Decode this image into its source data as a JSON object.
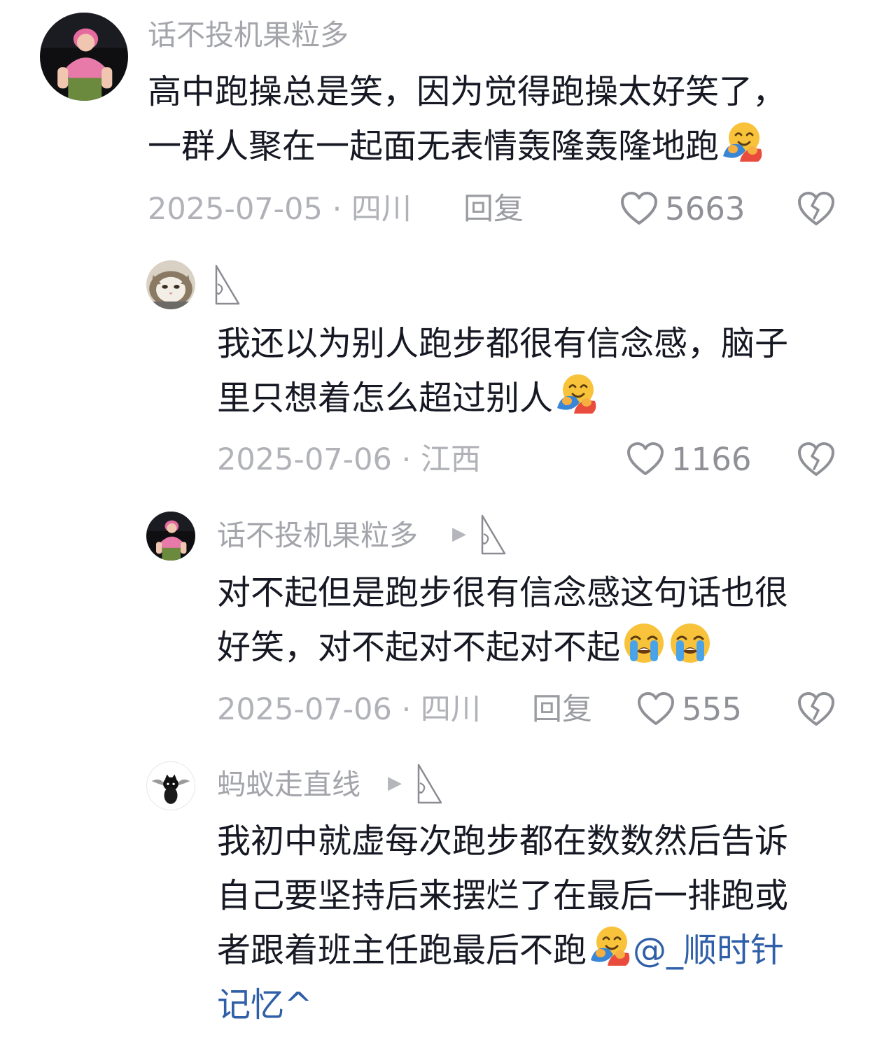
{
  "comments": [
    {
      "username": "话不投机果粒多",
      "lines": [
        "高中跑操总是笑，因为觉得跑操太好笑了，",
        "一群人聚在一起面无表情轰隆轰隆地跑"
      ],
      "date": "2025-07-05",
      "location": "四川",
      "reply_label": "回复",
      "likes": "5663",
      "emoji_icon": "hugging-face-emoji-icon"
    },
    {
      "username": "",
      "lines": [
        "我还以为别人跑步都很有信念感，脑子",
        "里只想着怎么超过别人"
      ],
      "date": "2025-07-06",
      "location": "江西",
      "likes": "1166",
      "emoji_icon": "hugging-face-emoji-icon"
    },
    {
      "username": "话不投机果粒多",
      "lines": [
        "对不起但是跑步很有信念感这句话也很",
        "好笑，对不起对不起对不起"
      ],
      "date": "2025-07-06",
      "location": "四川",
      "reply_label": "回复",
      "likes": "555",
      "emoji_icon": "crying-face-emoji-icon"
    },
    {
      "username": "蚂蚁走直线",
      "lines": [
        "我初中就虚每次跑步都在数数然后告诉",
        "自己要坚持后来摆烂了在最后一排跑或",
        "者跟着班主任跑最后不跑"
      ],
      "mention": "@_顺时针",
      "mention_cont": "记忆^",
      "emoji_icon": "hugging-face-emoji-icon"
    }
  ],
  "separator": " · ",
  "reply_arrow": "▶",
  "colors": {
    "text": "#161823",
    "meta": "#b0b2b8",
    "mention": "#2f5fa8",
    "heart": "#8f9197"
  }
}
